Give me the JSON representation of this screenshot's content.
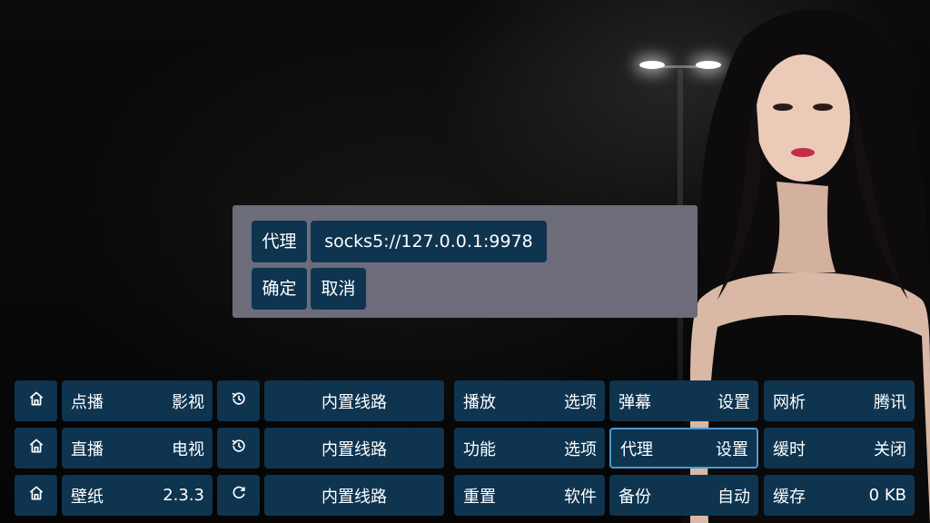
{
  "proxy_dialog": {
    "label": "代理",
    "value": "socks5://127.0.0.1:9978",
    "confirm": "确定",
    "cancel": "取消"
  },
  "rows": [
    {
      "home_icon": "home-icon",
      "left": {
        "label": "点播",
        "value": "影视"
      },
      "route_icon": "history-icon",
      "route": "内置线路",
      "col3": {
        "label": "播放",
        "value": "选项"
      },
      "col4": {
        "label": "弹幕",
        "value": "设置"
      },
      "col5": {
        "label": "网析",
        "value": "腾讯"
      }
    },
    {
      "home_icon": "home-icon",
      "left": {
        "label": "直播",
        "value": "电视"
      },
      "route_icon": "history-icon",
      "route": "内置线路",
      "col3": {
        "label": "功能",
        "value": "选项"
      },
      "col4": {
        "label": "代理",
        "value": "设置"
      },
      "col5": {
        "label": "缓时",
        "value": "关闭"
      }
    },
    {
      "home_icon": "home-icon",
      "left": {
        "label": "壁纸",
        "value": "2.3.3"
      },
      "route_icon": "refresh-icon",
      "route": "内置线路",
      "col3": {
        "label": "重置",
        "value": "软件"
      },
      "col4": {
        "label": "备份",
        "value": "自动"
      },
      "col5": {
        "label": "缓存",
        "value": "0 KB"
      }
    }
  ],
  "colors": {
    "button_bg": "#0e3450",
    "dialog_bg": "#6c6c7a",
    "focus_border": "#4a9bd6"
  }
}
